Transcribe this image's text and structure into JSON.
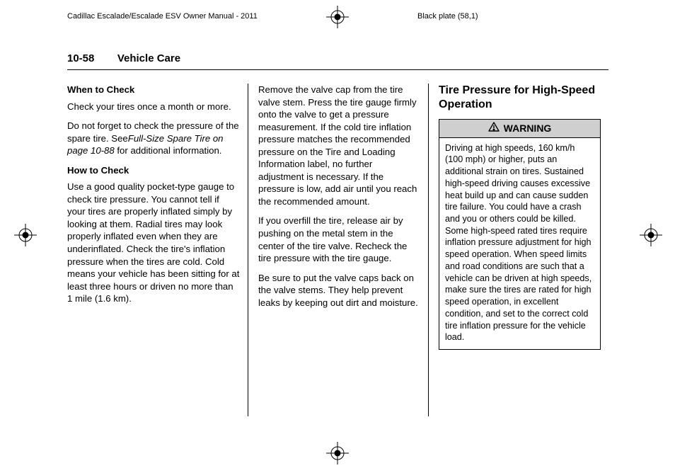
{
  "header": {
    "left": "Cadillac Escalade/Escalade ESV Owner Manual - 2011",
    "right": "Black plate (58,1)"
  },
  "section": {
    "page_num": "10-58",
    "title": "Vehicle Care"
  },
  "col1": {
    "h1": "When to Check",
    "p1": "Check your tires once a month or more.",
    "p2a": "Do not forget to check the pressure of the spare tire. See",
    "p2b_italic": "Full-Size Spare Tire on page 10‑88",
    "p2c": " for additional information.",
    "h2": "How to Check",
    "p3": "Use a good quality pocket-type gauge to check tire pressure. You cannot tell if your tires are properly inflated simply by looking at them. Radial tires may look properly inflated even when they are underinflated. Check the tire's inflation pressure when the tires are cold. Cold means your vehicle has been sitting for at least three hours or driven no more than 1 mile (1.6 km)."
  },
  "col2": {
    "p1": "Remove the valve cap from the tire valve stem. Press the tire gauge firmly onto the valve to get a pressure measurement. If the cold tire inflation pressure matches the recommended pressure on the Tire and Loading Information label, no further adjustment is necessary. If the pressure is low, add air until you reach the recommended amount.",
    "p2": "If you overfill the tire, release air by pushing on the metal stem in the center of the tire valve. Recheck the tire pressure with the tire gauge.",
    "p3": "Be sure to put the valve caps back on the valve stems. They help prevent leaks by keeping out dirt and moisture."
  },
  "col3": {
    "heading": "Tire Pressure for High-Speed Operation",
    "warn_label": "WARNING",
    "warn_body": "Driving at high speeds, 160 km/h (100 mph) or higher, puts an additional strain on tires. Sustained high-speed driving causes excessive heat build up and can cause sudden tire failure. You could have a crash and you or others could be killed. Some high-speed rated tires require inflation pressure adjustment for high speed operation. When speed limits and road conditions are such that a vehicle can be driven at high speeds, make sure the tires are rated for high speed operation, in excellent condition, and set to the correct cold tire inflation pressure for the vehicle load."
  }
}
